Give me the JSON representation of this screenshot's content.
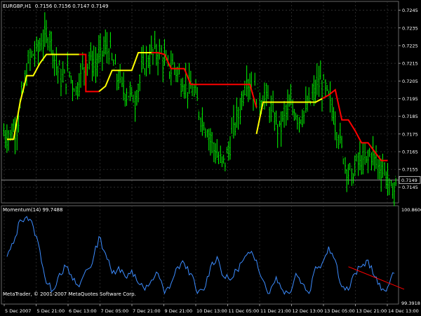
{
  "chart_data": [
    {
      "type": "candlestick",
      "pane": "price",
      "title": "EURGBP,H1",
      "ohlc_label": "0.7156 0.7156 0.7147 0.7149",
      "current_price": "0.7149",
      "ylim": [
        0.7136,
        0.725
      ],
      "y_ticks": [
        "0.7245",
        "0.7235",
        "0.7225",
        "0.7215",
        "0.7205",
        "0.7195",
        "0.7185",
        "0.7175",
        "0.7165",
        "0.7155",
        "0.7145",
        "0.7135"
      ],
      "colors": {
        "bars": "#00ff00",
        "stop_up": "#ffff00",
        "stop_down": "#ff0000",
        "grid": "#3a3a3a",
        "background": "#000000"
      },
      "grid": true,
      "close_approx": [
        0.7175,
        0.718,
        0.72,
        0.7218,
        0.7222,
        0.7228,
        0.7232,
        0.7215,
        0.7205,
        0.721,
        0.72,
        0.7212,
        0.7218,
        0.7214,
        0.7222,
        0.7224,
        0.721,
        0.7202,
        0.7198,
        0.7195,
        0.721,
        0.7218,
        0.7222,
        0.722,
        0.7212,
        0.7214,
        0.7206,
        0.7202,
        0.7198,
        0.7186,
        0.7178,
        0.7168,
        0.7158,
        0.7162,
        0.7178,
        0.719,
        0.7208,
        0.72,
        0.7195,
        0.7196,
        0.7185,
        0.7178,
        0.7188,
        0.719,
        0.7185,
        0.7188,
        0.7195,
        0.7205,
        0.72,
        0.719,
        0.7175,
        0.716,
        0.715,
        0.716,
        0.7158,
        0.7165,
        0.7158,
        0.7155,
        0.7142,
        0.7148
      ],
      "stop_segments": [
        {
          "trend": "up",
          "points": [
            [
              0,
              0.7172
            ],
            [
              1,
              0.7172
            ],
            [
              2,
              0.7193
            ],
            [
              3,
              0.7208
            ],
            [
              4,
              0.7208
            ],
            [
              5,
              0.7215
            ],
            [
              6,
              0.722
            ],
            [
              7,
              0.722
            ],
            [
              8,
              0.722
            ],
            [
              9,
              0.722
            ],
            [
              10,
              0.722
            ],
            [
              11,
              0.722
            ]
          ]
        },
        {
          "trend": "down",
          "points": [
            [
              11,
              0.722
            ],
            [
              12,
              0.722
            ],
            [
              12,
              0.7199
            ],
            [
              14,
              0.7199
            ]
          ]
        },
        {
          "trend": "up",
          "points": [
            [
              14,
              0.7199
            ],
            [
              15,
              0.7202
            ],
            [
              16,
              0.7211
            ],
            [
              17,
              0.7211
            ],
            [
              18,
              0.7211
            ],
            [
              19,
              0.7211
            ],
            [
              20,
              0.7221
            ],
            [
              22,
              0.7221
            ]
          ]
        },
        {
          "trend": "down",
          "points": [
            [
              22,
              0.7221
            ],
            [
              23,
              0.7221
            ],
            [
              24,
              0.722
            ],
            [
              25,
              0.7212
            ],
            [
              27,
              0.7212
            ],
            [
              28,
              0.7203
            ],
            [
              29,
              0.7203
            ],
            [
              30,
              0.7203
            ],
            [
              31,
              0.7203
            ]
          ]
        },
        {
          "trend": "down",
          "points": [
            [
              31,
              0.7203
            ],
            [
              36,
              0.7203
            ],
            [
              37,
              0.7203
            ],
            [
              38,
              0.719
            ]
          ]
        },
        {
          "trend": "up",
          "points": [
            [
              38,
              0.7175
            ],
            [
              39,
              0.7193
            ],
            [
              40,
              0.7193
            ],
            [
              47,
              0.7193
            ],
            [
              48,
              0.7195
            ]
          ]
        },
        {
          "trend": "down",
          "points": [
            [
              48,
              0.7195
            ],
            [
              49,
              0.7197
            ],
            [
              50,
              0.72
            ],
            [
              51,
              0.7183
            ],
            [
              52,
              0.7183
            ],
            [
              53,
              0.7177
            ],
            [
              54,
              0.717
            ],
            [
              55,
              0.717
            ],
            [
              56,
              0.7165
            ],
            [
              57,
              0.716
            ],
            [
              58,
              0.716
            ]
          ]
        }
      ]
    },
    {
      "type": "line",
      "pane": "indicator",
      "title": "Momentum(14) 99.7488",
      "ylim": [
        99.3918,
        100.8606
      ],
      "y_ticks": [
        "100.8606",
        "99.3918"
      ],
      "series": [
        {
          "color": "#3c8cff",
          "values": [
            100.1,
            100.3,
            100.65,
            100.7,
            100.55,
            100.2,
            99.7,
            99.6,
            99.85,
            99.95,
            99.75,
            99.65,
            99.9,
            100.0,
            100.4,
            100.15,
            99.85,
            99.95,
            99.8,
            99.9,
            99.7,
            99.6,
            99.75,
            99.85,
            99.55,
            99.7,
            99.95,
            100.0,
            99.85,
            99.55,
            99.6,
            99.95,
            100.1,
            99.8,
            99.75,
            99.9,
            100.05,
            100.15,
            100.05,
            99.75,
            99.55,
            99.8,
            99.6,
            99.55,
            99.85,
            99.7,
            99.55,
            99.95,
            100.0,
            100.25,
            100.05,
            99.65,
            99.6,
            99.85,
            99.95,
            100.05,
            99.8,
            99.6,
            99.65,
            99.85
          ]
        }
      ],
      "trendline": {
        "color": "#ff0000",
        "from": [
          52,
          99.95
        ],
        "to": [
          59,
          99.55
        ]
      }
    }
  ],
  "x_ticks": [
    "5 Dec 2007",
    "5 Dec 21:00",
    "6 Dec 13:00",
    "7 Dec 05:00",
    "7 Dec 21:00",
    "9 Dec 21:00",
    "10 Dec 13:00",
    "11 Dec 05:00",
    "11 Dec 21:00",
    "12 Dec 13:00",
    "13 Dec 05:00",
    "13 Dec 21:00",
    "14 Dec 13:00"
  ],
  "copyright": "MetaTrader, © 2001-2007 MetaQuotes Software Corp."
}
